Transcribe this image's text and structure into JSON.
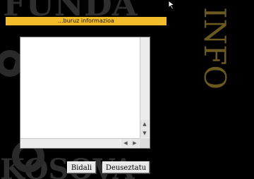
{
  "banner": {
    "text": "...buruz informazioa"
  },
  "side_logo": {
    "text": "INFO"
  },
  "background_art": {
    "text": "FUNDAZIO KOSOVA"
  },
  "textarea": {
    "value": ""
  },
  "buttons": {
    "send_label": "Bidali",
    "clear_label": "Deuseztatu"
  },
  "colors": {
    "banner": "#f3bc2b",
    "side_logo": "#6b5a20",
    "background_text": "#2e2e2e"
  },
  "icons": {
    "cursor": "mouse-pointer-icon"
  }
}
